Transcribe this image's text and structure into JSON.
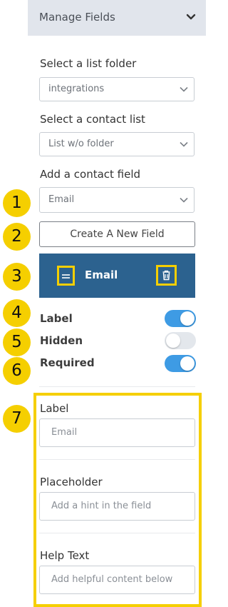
{
  "header": {
    "title": "Manage Fields",
    "chevron": "chevron-down-icon"
  },
  "list_folder": {
    "label": "Select a list folder",
    "value": "integrations"
  },
  "contact_list": {
    "label": "Select a contact list",
    "value": "List w/o folder"
  },
  "contact_field": {
    "label": "Add a contact field",
    "value": "Email"
  },
  "create_button": "Create A New Field",
  "field_item": {
    "name": "Email",
    "handle_icon": "drag-handle-icon",
    "delete_icon": "trash-icon"
  },
  "toggles": [
    {
      "label": "Label",
      "on": true
    },
    {
      "label": "Hidden",
      "on": false
    },
    {
      "label": "Required",
      "on": true
    }
  ],
  "settings": {
    "label": {
      "title": "Label",
      "placeholder": "Email"
    },
    "placeholder": {
      "title": "Placeholder",
      "placeholder": "Add a hint in the field"
    },
    "help_text": {
      "title": "Help Text",
      "placeholder": "Add helpful content below"
    }
  },
  "badges": [
    "1",
    "2",
    "3",
    "4",
    "5",
    "6",
    "7"
  ],
  "colors": {
    "accent": "#2c628f",
    "highlight": "#f5cf00",
    "toggle_on": "#3e9be4",
    "header_bg": "#e1e5ec"
  }
}
